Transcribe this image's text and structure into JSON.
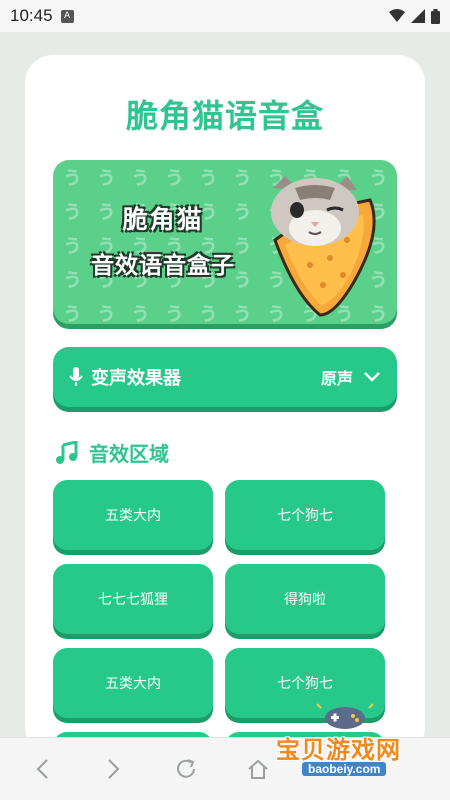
{
  "status": {
    "time": "10:45",
    "notification_icon": "A"
  },
  "app": {
    "title": "脆角猫语音盒"
  },
  "banner": {
    "line1": "脆角猫",
    "line2": "音效语音盒子"
  },
  "effect": {
    "label": "变声效果器",
    "value": "原声"
  },
  "section": {
    "title": "音效区域"
  },
  "sounds": [
    {
      "label": "五类大内"
    },
    {
      "label": "七个狗七"
    },
    {
      "label": "七七七狐狸"
    },
    {
      "label": "得狗啦"
    },
    {
      "label": "五类大内"
    },
    {
      "label": "七个狗七"
    },
    {
      "label": ""
    },
    {
      "label": ""
    }
  ],
  "watermark": {
    "text": "宝贝游戏网",
    "url": "baobeiy.com"
  },
  "colors": {
    "accent": "#2fc58f",
    "button": "#27c98b",
    "button_shadow": "#1b9c69",
    "banner": "#5bd08b"
  }
}
